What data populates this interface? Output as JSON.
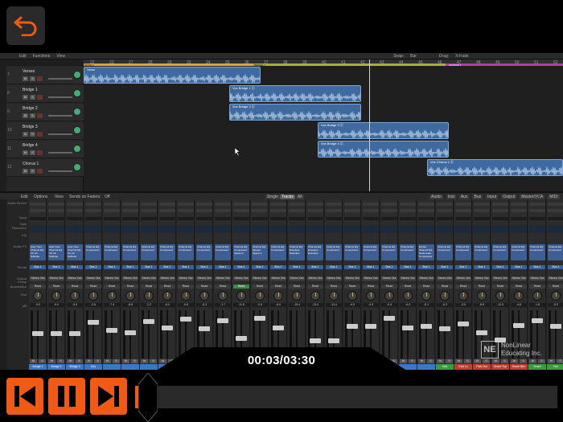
{
  "colors": {
    "accent": "#f05a14",
    "region": "#3e6aa0",
    "bg": "#000000"
  },
  "top": {
    "back_icon": "undo-arrow-icon"
  },
  "arrange": {
    "toolbar": [
      "Edit",
      "Functions",
      "View",
      "Snap:",
      "Bar",
      "Drag:",
      "X-Fade"
    ],
    "ruler": [
      "22",
      "23",
      "27",
      "28",
      "29",
      "33",
      "34",
      "35",
      "36",
      "37",
      "38",
      "39",
      "40",
      "41",
      "42",
      "43",
      "44",
      "45",
      "46",
      "47",
      "48",
      "49",
      "50",
      "51",
      "52"
    ],
    "markers": [
      {
        "label": "INTRO 1",
        "color": "#d8a838"
      },
      {
        "label": "BRIDGE 1",
        "color": "#a8b038"
      },
      {
        "label": "CHORUS 1",
        "color": "#b83aa8"
      }
    ],
    "tracks": [
      {
        "num": "7",
        "name": "Verses"
      },
      {
        "num": "8",
        "name": "Bridge 1"
      },
      {
        "num": "9",
        "name": "Bridge 2"
      },
      {
        "num": "10",
        "name": "Bridge 3"
      },
      {
        "num": "11",
        "name": "Bridge 4"
      },
      {
        "num": "12",
        "name": "Chorus 1"
      }
    ],
    "regions": [
      {
        "name": "Verse",
        "track": 0
      },
      {
        "name": "Vox Bridge 1 Ⓒ",
        "track": 1
      },
      {
        "name": "Vox Bridge 2 Ⓒ",
        "track": 2
      },
      {
        "name": "Vox Bridge 3 Ⓒ",
        "track": 3
      },
      {
        "name": "Vox Bridge 4 Ⓒ",
        "track": 4
      },
      {
        "name": "Vox Chorus 1 Ⓒ",
        "track": 5
      }
    ]
  },
  "mixer": {
    "toolbar": {
      "edit": "Edit",
      "options": "Options",
      "view": "View",
      "sends": "Sends on Faders:",
      "off": "Off",
      "single": "Single",
      "tracks": "Tracks",
      "all": "All",
      "filters": [
        "Audio",
        "Inst",
        "Aux",
        "Bus",
        "Input",
        "Output",
        "Master/VCA",
        "MIDI"
      ]
    },
    "row_labels": [
      "Audio Device",
      "Input",
      "Gain Reduction",
      "EQ",
      "Audio FX",
      "Sends",
      "Output",
      "Group",
      "Automation",
      "Pan",
      "dB"
    ],
    "strips": [
      {
        "plug": "Auto-Tune Channel EQ VC 2A Softtube",
        "bus": "Bus 1",
        "read": "Read",
        "db": "-9.0",
        "name": "Bridge 1",
        "color": "#3b78c4"
      },
      {
        "plug": "Auto-Tune Channel EQ VC 2A Softtube",
        "bus": "Bus 1",
        "read": "Read",
        "db": "-9.0",
        "name": "Bridge 2",
        "color": "#3b78c4"
      },
      {
        "plug": "Auto-Tune Channel EQ VC 2A Softtube",
        "bus": "Bus 1",
        "read": "Read",
        "db": "-9.0",
        "name": "Bridge 3",
        "color": "#3b78c4"
      },
      {
        "plug": "Channel EQ Compressor",
        "bus": "Bus 1",
        "read": "Read",
        "db": "-2.6",
        "name": "Cho",
        "color": "#3b78c4"
      },
      {
        "plug": "Channel EQ Compressor",
        "bus": "Bus 1",
        "read": "Read",
        "db": "-7.4",
        "name": "",
        "color": "#3b78c4"
      },
      {
        "plug": "Channel EQ Compressor",
        "bus": "Bus 1",
        "read": "Read",
        "db": "-8.8",
        "name": "",
        "color": "#3b78c4"
      },
      {
        "plug": "Channel EQ Compressor",
        "bus": "Bus 1",
        "read": "Read",
        "db": "-2.2",
        "name": "",
        "color": "#3b78c4"
      },
      {
        "plug": "Channel EQ Compressor",
        "bus": "Bus 1",
        "read": "Read",
        "db": "-6.0",
        "name": "",
        "color": "#3b78c4"
      },
      {
        "plug": "Channel EQ Compressor",
        "bus": "Bus 1",
        "read": "Read",
        "db": "-0.8",
        "name": "",
        "color": "#3b78c4"
      },
      {
        "plug": "Channel EQ Compressor",
        "bus": "Bus 1",
        "read": "Read",
        "db": "-6.3",
        "name": "",
        "color": "#3b78c4"
      },
      {
        "plug": "Channel EQ Compressor",
        "bus": "Bus 1",
        "read": "Read",
        "db": "-1.7",
        "name": "",
        "color": "#3b78c4"
      },
      {
        "plug": "Channel EQ Compressor Space D",
        "bus": "Bus 2",
        "read": "Read",
        "db": "-11.8",
        "name": "",
        "color": "#3b78c4"
      },
      {
        "plug": "Channel EQ Spread Space D",
        "bus": "Bus 2",
        "read": "Read",
        "db": "-0.6",
        "name": "",
        "color": "#3b78c4"
      },
      {
        "plug": "Channel EQ Compressor",
        "bus": "Bus 2",
        "read": "Read",
        "db": "-6.0",
        "name": "",
        "color": "#3b78c4"
      },
      {
        "plug": "Channel EQ Envelope Distortion",
        "bus": "Bus 1",
        "read": "Read",
        "db": "-19.4",
        "name": "",
        "color": "#3b78c4"
      },
      {
        "plug": "Channel EQ Envelope Distortion",
        "bus": "Bus 1",
        "read": "Read",
        "db": "-13.4",
        "name": "",
        "color": "#3b78c4"
      },
      {
        "plug": "Channel EQ Compressor",
        "bus": "Bus 1",
        "read": "Read",
        "db": "-13.4",
        "name": "",
        "color": "#3b78c4"
      },
      {
        "plug": "Channel EQ Compressor",
        "bus": "Bus 1",
        "read": "Read",
        "db": "-4.9",
        "name": "",
        "color": "#3b78c4"
      },
      {
        "plug": "Channel EQ Compressor",
        "bus": "Bus 1",
        "read": "Read",
        "db": "-4.9",
        "name": "",
        "color": "#3b78c4"
      },
      {
        "plug": "Channel EQ Compressor",
        "bus": "Bus 1",
        "read": "Read",
        "db": "-0.4",
        "name": "",
        "color": "#3b78c4"
      },
      {
        "plug": "Channel EQ Compressor",
        "bus": "Bus 1",
        "read": "Read",
        "db": "-6.0",
        "name": "",
        "color": "#3b78c4"
      },
      {
        "plug": "Exciter Channel EQ Noise Gate Compressor",
        "bus": "Bus 1",
        "read": "Read",
        "db": "-5.1",
        "name": "",
        "color": "#3b78c4"
      },
      {
        "plug": "Channel EQ Compressor",
        "bus": "Bus 1",
        "read": "Read",
        "db": "-6.3",
        "name": "Kick",
        "color": "#3d9a3d"
      },
      {
        "plug": "Channel EQ Compressor",
        "bus": "Bus 1",
        "read": "Read",
        "db": "-3.5",
        "name": "Kick Ls",
        "color": "#c04030"
      },
      {
        "plug": "Channel EQ Compressor",
        "bus": "Bus 1",
        "read": "Read",
        "db": "-8.8",
        "name": "Pick Out",
        "color": "#c04030"
      },
      {
        "plug": "Channel EQ Compressor",
        "bus": "Bus 1",
        "read": "Read",
        "db": "-12.5",
        "name": "Snare Top",
        "color": "#c04030"
      },
      {
        "plug": "Channel EQ Compressor",
        "bus": "Bus 1",
        "read": "Read",
        "db": "-4.6",
        "name": "Snare Btm",
        "color": "#c04030"
      },
      {
        "plug": "Channel EQ Compressor",
        "bus": "Bus 1",
        "read": "Read",
        "db": "-1.8",
        "name": "Snare",
        "color": "#3d9a3d"
      },
      {
        "plug": "Channel EQ Compressor",
        "bus": "Bus 1",
        "read": "Read",
        "db": "-5.0",
        "name": "Tom",
        "color": "#3d9a3d"
      },
      {
        "plug": "Channel EQ Compressor",
        "bus": "Bus 1",
        "read": "Read",
        "db": "-7.0",
        "name": "To",
        "color": "#3d9a3d"
      }
    ],
    "stereo_out": "Stereo Out",
    "mute": "M",
    "solo": "S"
  },
  "player": {
    "time": "00:03/03:30",
    "progress": 0.015,
    "watermark_mark": "NE",
    "watermark_text": "NonLinear Educating Inc.",
    "buttons": [
      "skip-back-icon",
      "pause-icon",
      "skip-forward-icon"
    ]
  }
}
